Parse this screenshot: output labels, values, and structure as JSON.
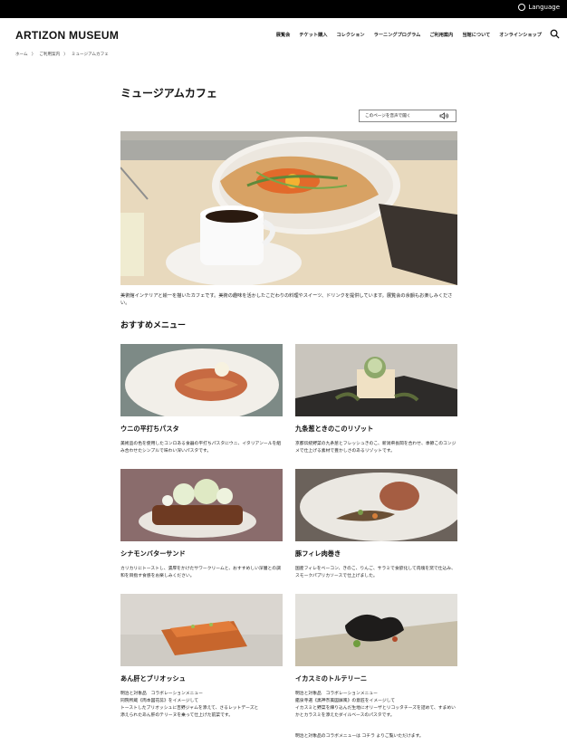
{
  "topbar": {
    "language": "Language"
  },
  "header": {
    "logo": "ARTIZON MUSEUM",
    "nav": [
      "展覧会",
      "チケット購入",
      "コレクション",
      "ラーニングプログラム",
      "ご利用案内",
      "当館について",
      "オンラインショップ"
    ]
  },
  "breadcrumb": [
    "ホーム",
    "ご利用案内",
    "ミュージアムカフェ"
  ],
  "page": {
    "title": "ミュージアムカフェ",
    "speech_label": "このページを音声で聞く",
    "intro": "美術館インテリアと絵一を描いたカフェです。美術の趣味を活かしたこだわりの料理やスイーツ、ドリンクを提供しています。展覧会の余韻もお楽しみください。",
    "section_title": "おすすめメニュー"
  },
  "menu": [
    {
      "name": "ウニの平打ちパスタ",
      "desc": "美術品の色を使用したコンロある食器の平打ちパスタにウニ、イタリアンールを組み合わせたシンプルで味わい深いパスタです。"
    },
    {
      "name": "九条葱ときのこのリゾット",
      "desc": "京都伝統野菜の九条葱とフレッシュきのこ、新潟県長岡を合わせ、季節このコンジメで仕上げる素材で豊かしさのあるリゾットです。"
    },
    {
      "name": "シナモンバターサンド",
      "desc": "カリカリにトーストし、濃厚をかけたサワークリームと、おすすめしい深層との調和を目指す食感をお楽しみください。"
    },
    {
      "name": "豚フィレ肉巻き",
      "desc": "国産フィレをベーコン、きのこ、りんご、サラミで食欲化して肉塊を窯で仕込み、スモークパプリカソースで仕上げました。"
    },
    {
      "name": "あん肝とブリオッシュ",
      "desc": "明治と対象品　コラボレーションメニュー\n同院所蔵《両本図花蕊》をイメージして\nトーストしたブリオッシュに吉野ジャムを添えて、さるレットデーズと\n添えられたあん肝のテリーヌを乗って仕上げた前菜です。"
    },
    {
      "name": "イカスミのトルテリーニ",
      "desc": "明治と対象品　コラボレーションメニュー\n鑑泉寺選《黒神奈美図屏風》の意匠をイメージして\nイカスミと野菜を練り込んだ生地にオリーザとリコッタチーズを詰めて、すまめいかとカラスミを添えたダイルベースのパスタです。"
    }
  ],
  "footnote": "明治と対象品のコラボメニューは コチラ よりご覧いただけます。"
}
